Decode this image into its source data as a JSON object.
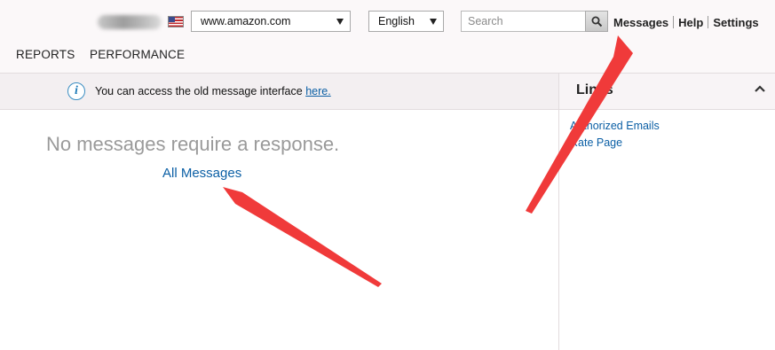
{
  "header": {
    "marketplace": "www.amazon.com",
    "language": "English",
    "search_placeholder": "Search",
    "links": [
      "Messages",
      "Help",
      "Settings"
    ]
  },
  "nav": {
    "items": [
      "REPORTS",
      "PERFORMANCE"
    ]
  },
  "info_banner": {
    "text": "You can access the old message interface ",
    "link": "here."
  },
  "main": {
    "empty_message": "No messages require a response.",
    "all_messages_link": "All Messages"
  },
  "links_panel": {
    "title": "Links",
    "items": [
      "Authorized Emails",
      "Rate Page"
    ]
  },
  "colors": {
    "link": "#0b5fa5",
    "annotation_arrow": "#f03a3a",
    "header_bg": "#fbf8f9"
  },
  "icons": [
    "us-flag-icon",
    "search-icon",
    "info-icon",
    "chevron-up-icon"
  ]
}
